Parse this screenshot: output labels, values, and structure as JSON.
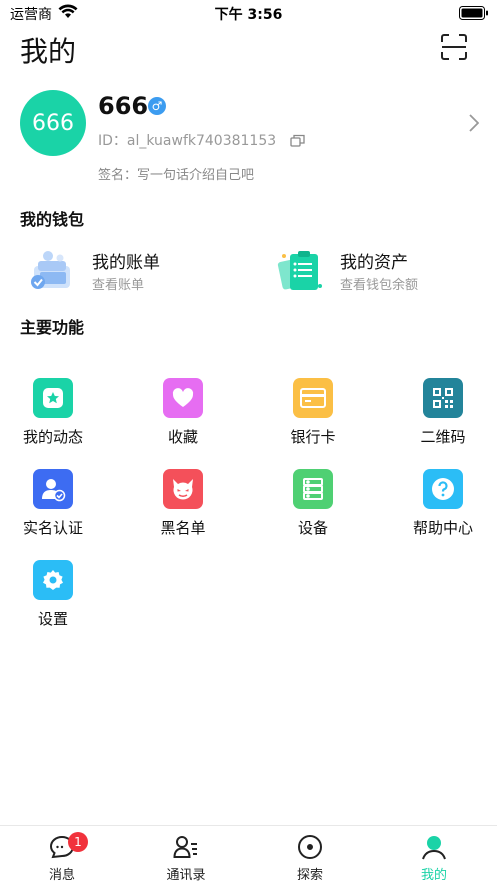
{
  "status_bar": {
    "carrier": "运营商",
    "time": "下午 3:56"
  },
  "header": {
    "title": "我的"
  },
  "profile": {
    "avatar_text": "666",
    "nickname": "666",
    "user_id": "ID：al_kuawfk740381153",
    "signature": "签名：写一句话介绍自己吧",
    "gender_symbol": "♂"
  },
  "wallet": {
    "title": "我的钱包",
    "items": [
      {
        "title": "我的账单",
        "subtitle": "查看账单"
      },
      {
        "title": "我的资产",
        "subtitle": "查看钱包余额"
      }
    ]
  },
  "features": {
    "title": "主要功能",
    "items": [
      {
        "label": "我的动态",
        "color": "#1ad3a7"
      },
      {
        "label": "收藏",
        "color": "#e66df2"
      },
      {
        "label": "银行卡",
        "color": "#fbbf45"
      },
      {
        "label": "二维码",
        "color": "#23849a"
      },
      {
        "label": "实名认证",
        "color": "#3d6cf2"
      },
      {
        "label": "黑名单",
        "color": "#f4505a"
      },
      {
        "label": "设备",
        "color": "#4fd073"
      },
      {
        "label": "帮助中心",
        "color": "#2bbdf6"
      },
      {
        "label": "设置",
        "color": "#2bbdf6"
      }
    ]
  },
  "tabbar": {
    "active_color": "#1ad3a7",
    "items": [
      {
        "label": "消息",
        "badge": "1"
      },
      {
        "label": "通讯录"
      },
      {
        "label": "探索"
      },
      {
        "label": "我的"
      }
    ]
  }
}
